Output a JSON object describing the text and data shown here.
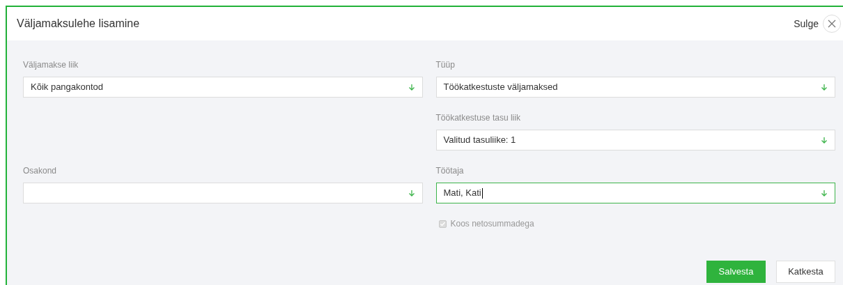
{
  "dialog": {
    "title": "Väljamaksulehe lisamine",
    "close_label": "Sulge"
  },
  "rows": [
    {
      "left": {
        "label": "Väljamakse liik",
        "value": "Kõik pangakontod",
        "focused": false
      },
      "right": {
        "label": "Tüüp",
        "value": "Töökatkestuste väljamaksed",
        "focused": false
      }
    },
    {
      "right": {
        "label": "Töökatkestuse tasu liik",
        "value": "Valitud tasuliike: 1",
        "focused": false
      }
    },
    {
      "left": {
        "label": "Osakond",
        "focused": false
      },
      "right": {
        "label": "Töötaja",
        "value": "Mati, Kati",
        "focused": true
      }
    }
  ],
  "checkbox": {
    "label": "Koos netosummadega",
    "checked": true,
    "disabled": true
  },
  "buttons": [
    {
      "label": "Salvesta",
      "kind": "primary"
    },
    {
      "label": "Katkesta",
      "kind": "secondary"
    }
  ]
}
